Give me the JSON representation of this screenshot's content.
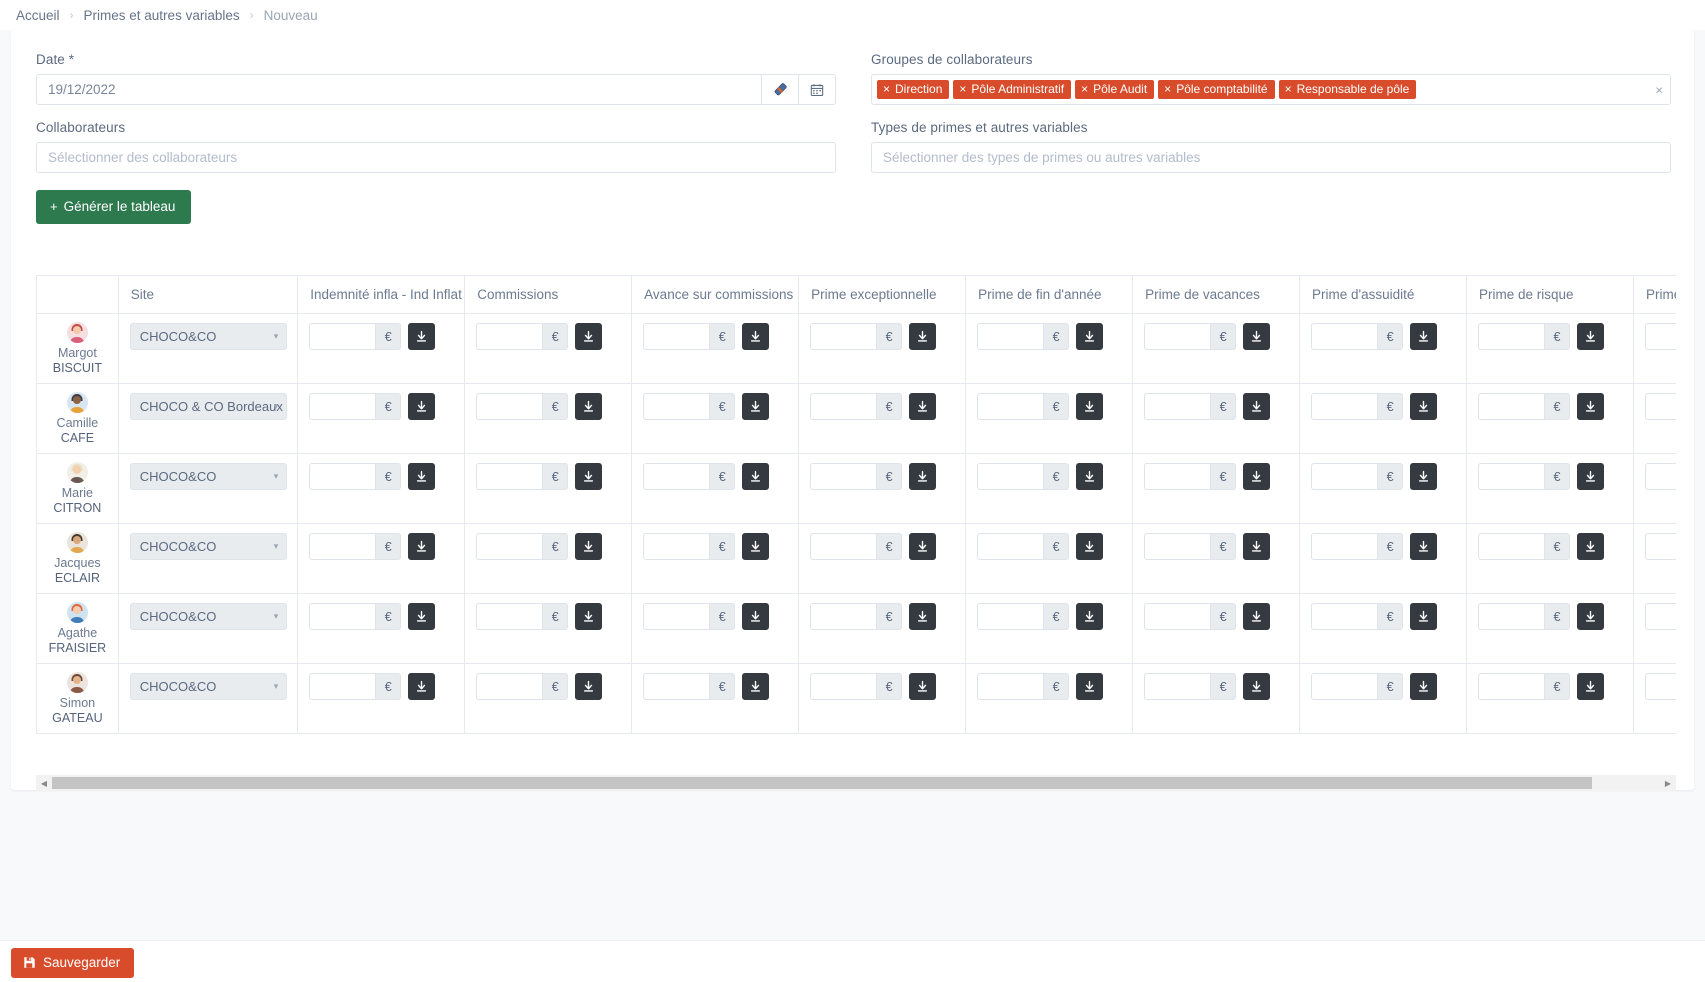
{
  "breadcrumb": {
    "items": [
      {
        "label": "Accueil",
        "current": false
      },
      {
        "label": "Primes et autres variables",
        "current": false
      },
      {
        "label": "Nouveau",
        "current": true
      }
    ],
    "separator": "›"
  },
  "form": {
    "date": {
      "label": "Date *",
      "value": "19/12/2022",
      "eraser_icon": "eraser-icon",
      "calendar_icon": "calendar-icon"
    },
    "collaborateurs": {
      "label": "Collaborateurs",
      "value": "",
      "placeholder": "Sélectionner des collaborateurs"
    },
    "groupes": {
      "label": "Groupes de collaborateurs",
      "tags": [
        "Direction",
        "Pôle Administratif",
        "Pôle Audit",
        "Pôle comptabilité",
        "Responsable de pôle"
      ],
      "tag_remove_glyph": "×",
      "clear_all_glyph": "×",
      "tag_color": "#d94c2b"
    },
    "types_primes": {
      "label": "Types de primes et autres variables",
      "value": "",
      "placeholder": "Sélectionner des types de primes ou autres variables"
    },
    "generate_button": {
      "label": "Générer le tableau",
      "plus": "+",
      "color": "#2d7a4f"
    }
  },
  "table": {
    "headers": [
      "",
      "Site",
      "Indemnité infla - Ind Inflat",
      "Commissions",
      "Avance sur commissions",
      "Prime exceptionnelle",
      "Prime de fin d'année",
      "Prime de vacances",
      "Prime d'assuidité",
      "Prime de risque",
      "Prime de froid"
    ],
    "currency_suffix": "€",
    "fill_icon": "arrow-down-icon",
    "caret_glyph": "▾",
    "rows": [
      {
        "first_name": "Margot",
        "last_name": "BISCUIT",
        "site": "CHOCO&CO",
        "avatar": {
          "bg": "#f6dfe0",
          "hair": "#c24a4a",
          "face": "#f4c9a8",
          "body": "#d9607c"
        },
        "values": [
          "",
          "",
          "",
          "",
          "",
          "",
          "",
          "",
          ""
        ]
      },
      {
        "first_name": "Camille",
        "last_name": "CAFE",
        "site": "CHOCO & CO Bordeaux",
        "avatar": {
          "bg": "#d8e6f2",
          "hair": "#3b3b44",
          "face": "#8a6245",
          "body": "#e8a33d"
        },
        "values": [
          "",
          "",
          "",
          "",
          "",
          "",
          "",
          "",
          ""
        ]
      },
      {
        "first_name": "Marie",
        "last_name": "CITRON",
        "site": "CHOCO&CO",
        "avatar": {
          "bg": "#f1efe6",
          "hair": "#e8dfc0",
          "face": "#f4cfae",
          "body": "#6b5a52"
        },
        "values": [
          "",
          "",
          "",
          "",
          "",
          "",
          "",
          "",
          ""
        ]
      },
      {
        "first_name": "Jacques",
        "last_name": "ECLAIR",
        "site": "CHOCO&CO",
        "avatar": {
          "bg": "#e9e4dc",
          "hair": "#4a3a2e",
          "face": "#d8a87c",
          "body": "#e0a94f"
        },
        "values": [
          "",
          "",
          "",
          "",
          "",
          "",
          "",
          "",
          ""
        ]
      },
      {
        "first_name": "Agathe",
        "last_name": "FRAISIER",
        "site": "CHOCO&CO",
        "avatar": {
          "bg": "#cfe3f0",
          "hair": "#e2653a",
          "face": "#f3cdb0",
          "body": "#3f7fb5"
        },
        "values": [
          "",
          "",
          "",
          "",
          "",
          "",
          "",
          "",
          ""
        ]
      },
      {
        "first_name": "Simon",
        "last_name": "GATEAU",
        "site": "CHOCO&CO",
        "avatar": {
          "bg": "#ece4df",
          "hair": "#6b4a3a",
          "face": "#e6b48c",
          "body": "#8a5a46"
        },
        "values": [
          "",
          "",
          "",
          "",
          "",
          "",
          "",
          "",
          ""
        ]
      }
    ]
  },
  "scrollbar": {
    "left_arrow": "◀",
    "right_arrow": "▶"
  },
  "footer": {
    "save_label": "Sauvegarder",
    "save_icon": "save-disk-icon",
    "save_color": "#d94c2b"
  }
}
